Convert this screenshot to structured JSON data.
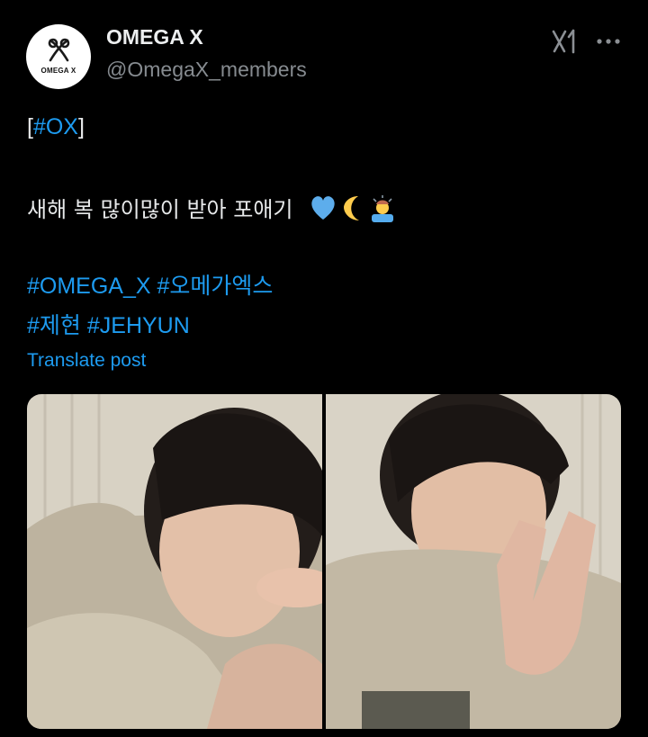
{
  "tweet": {
    "author": {
      "display_name": "OMEGA X",
      "handle": "@OmegaX_members",
      "avatar_text": "OMEGA X"
    },
    "lines": {
      "tag_open": "[",
      "tag": "#OX",
      "tag_close": "]",
      "message": "새해 복 많이많이 받아 포애기",
      "hashtag_1": "#OMEGA_X",
      "hashtag_2": "#오메가엑스",
      "hashtag_3": "#제현",
      "hashtag_4": "#JEHYUN"
    },
    "emojis": [
      "blue-heart-icon",
      "crescent-moon-icon",
      "person-gesturing-icon"
    ],
    "translate_label": "Translate post",
    "media": [
      {
        "name": "selfie-photo-1",
        "description_icon": "photo"
      },
      {
        "name": "selfie-photo-2",
        "description_icon": "photo"
      }
    ]
  },
  "toolbar": {
    "icons": [
      "grok-icon",
      "more-options-icon"
    ]
  },
  "colors": {
    "background": "#000000",
    "text": "#e7e9ea",
    "secondary": "#868b90",
    "link": "#1d9bf0"
  }
}
